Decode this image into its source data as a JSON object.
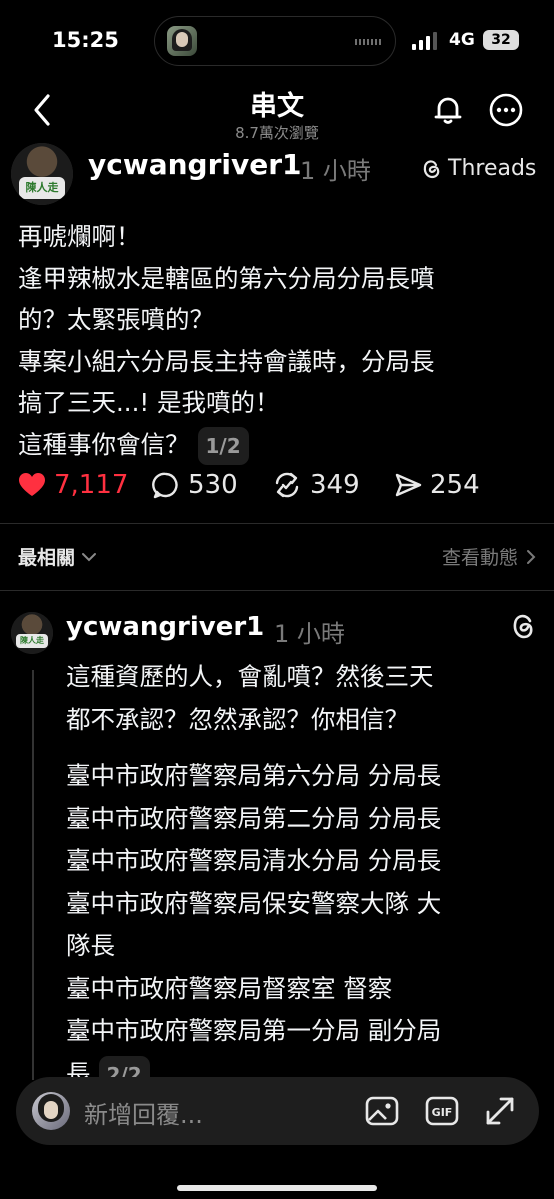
{
  "status_bar": {
    "time": "15:25",
    "network": "4G",
    "battery": "32"
  },
  "nav": {
    "title": "串文",
    "views": "8.7萬次瀏覽"
  },
  "post": {
    "username": "ycwangriver1",
    "time": "1 小時",
    "platform_label": "Threads",
    "avatar_badge": "陳人走",
    "lines": [
      "再唬爛啊！",
      "逢甲辣椒水是轄區的第六分局分局長噴",
      "的？太緊張噴的？",
      "專案小組六分局長主持會議時，分局長",
      "搞了三天...! 是我噴的！",
      "這種事你會信？"
    ],
    "page_indicator": "1/2",
    "likes": "7,117",
    "comments": "530",
    "reposts": "349",
    "shares": "254"
  },
  "sort": {
    "label": "最相關",
    "activity_link": "查看動態"
  },
  "reply": {
    "username": "ycwangriver1",
    "time": "1 小時",
    "lines_top": [
      "這種資歷的人，會亂噴？然後三天",
      "都不承認？忽然承認？你相信？"
    ],
    "lines": [
      "臺中市政府警察局第六分局 分局長",
      "臺中市政府警察局第二分局 分局長",
      "臺中市政府警察局清水分局 分局長",
      "臺中市政府警察局保安警察大隊 大",
      "隊長",
      "臺中市政府警察局督察室 督察",
      "臺中市政府警察局第一分局 副分局",
      "長"
    ],
    "page_indicator": "2/2"
  },
  "composer": {
    "placeholder": "新增回覆..."
  },
  "colors": {
    "background": "#000000",
    "like_red": "#ff3040",
    "muted": "#7a7a7a"
  }
}
